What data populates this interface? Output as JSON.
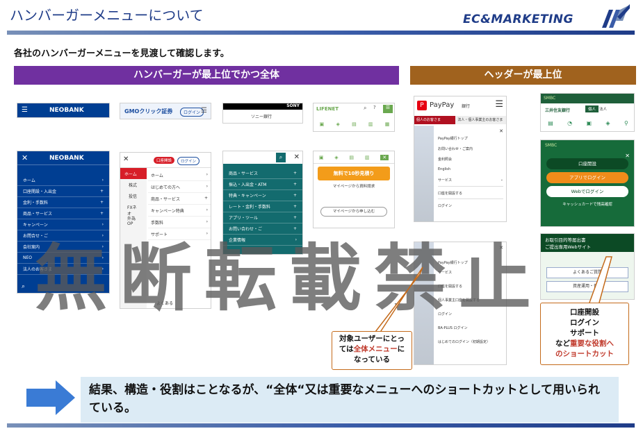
{
  "header": {
    "title": "ハンバーガーメニューについて",
    "logo_text": "EC&MARKETING"
  },
  "subtitle": "各社のハンバーガーメニューを見渡して確認します。",
  "sections": {
    "left_label": "ハンバーガーが最上位でかつ全体",
    "right_label": "ヘッダーが最上位"
  },
  "shots": {
    "neobank": {
      "brand": "NEOBANK",
      "items": [
        "ホーム",
        "口座開設・入出金",
        "金利・手数料",
        "商品・サービス",
        "キャンペーン",
        "お問合せ・ご",
        "会社案内",
        "NEO",
        "法人のお客さま"
      ]
    },
    "gmo": {
      "brand": "GMOクリック証券",
      "login": "ログイン",
      "open": "口座開設",
      "tabs": [
        "ホーム",
        "株式",
        "投信",
        "FXネオ",
        "外為OP"
      ],
      "items": [
        "ホーム",
        "はじめての方へ",
        "商品・サービス",
        "キャンペーン特典",
        "手数料",
        "サポート",
        "よくある"
      ]
    },
    "sony": {
      "brand": "SONY",
      "bank": "ソニー銀行",
      "items": [
        "商品・サービス",
        "振込・入出金・ATM",
        "特典・キャンペーン",
        "レート・金利・手数料",
        "アプリ・ツール",
        "お問い合わせ・ご",
        "企業情報"
      ]
    },
    "lifenet": {
      "brand": "LIFENET",
      "cta": "無料で10秒見積り",
      "note": "マイページから資料請求",
      "button": "マイページから申し込む"
    },
    "paypay": {
      "brand": "PayPay",
      "sub": "銀行",
      "tab": "個人のお客さま",
      "tab2": "法人・個人事業主のお客さま",
      "items": [
        "PayPay銀行トップ",
        "お問い合わせ・ご案内",
        "金利照会",
        "English",
        "サービス",
        "口座を開設する",
        "ログイン"
      ],
      "lower_items": [
        "PayPay銀行トップ",
        "サービス",
        "口座を開設する",
        "個人事業主口座を開設する",
        "ログイン",
        "BA-PLUS ログイン",
        "はじめてのログイン（初期設定）"
      ]
    },
    "smbc": {
      "brand": "SMBC",
      "bank": "三井住友銀行",
      "tabs": [
        "個人",
        "法人"
      ],
      "buttons": [
        "口座開設",
        "アプリでログイン",
        "Webでログイン",
        "キャッシュカードで残高確認"
      ],
      "banner": "お取引目的等届出書",
      "banner2": "ご提出専用Webサイト",
      "faq": "よくあるご質問",
      "asset": "資産運用・保険"
    }
  },
  "watermark": "無断転載禁止",
  "callouts": {
    "left": [
      "対象ユーザーにとっ",
      "ては",
      "全体メニュー",
      "に",
      "なっている"
    ],
    "right": [
      "口座開設",
      "ログイン",
      "サポート",
      "など",
      "重要な役割へ",
      "のショートカット"
    ]
  },
  "conclusion": "結果、構造・役割はことなるが、“全体“又は重要なメニューへのショートカットとして用いられている。",
  "colors": {
    "purple": "#7030a0",
    "brown": "#a0621e",
    "navy": "#1f3c88",
    "arrow_blue": "#3a7bd5",
    "orange": "#c46a1a"
  }
}
